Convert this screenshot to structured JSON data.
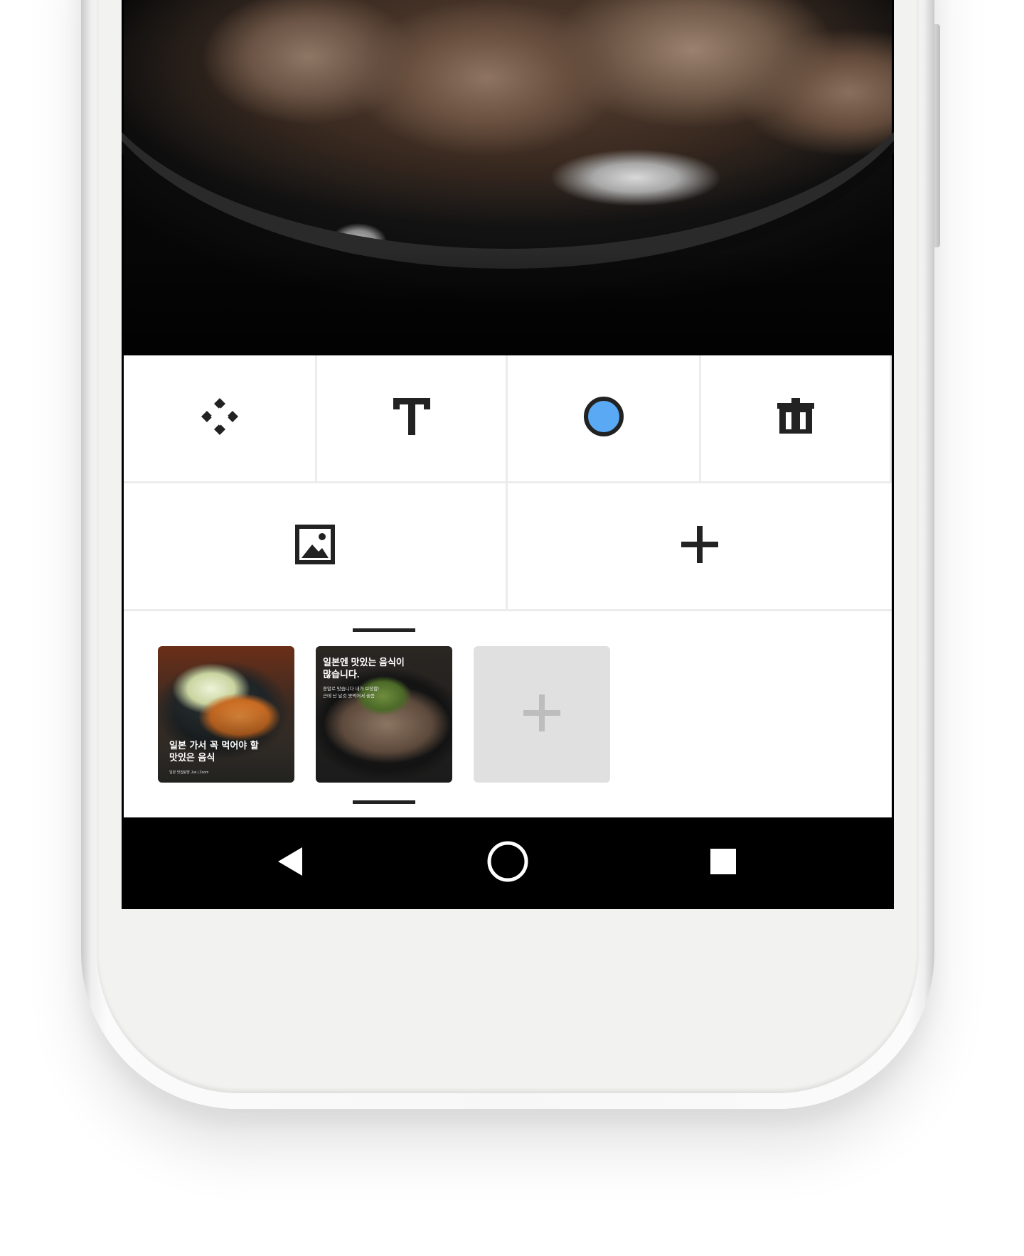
{
  "toolbar": {
    "move_icon": "move-icon",
    "text_icon": "text-icon",
    "color_icon": "color-dot-icon",
    "delete_icon": "trash-icon",
    "image_icon": "image-icon",
    "add_icon": "plus-icon"
  },
  "colors": {
    "accent_dot": "#5aa9f5",
    "icon": "#222222",
    "add_tile": "#e0e0e0"
  },
  "slides": [
    {
      "caption": "일본 가서 꼭 먹어야 할\n맛있은 음식",
      "subcaption": "일본 맛집탐방 Jun | Zoom"
    },
    {
      "title": "일본엔 맛있는 음식이\n많습니다.",
      "body": "종말로 맛습니다 내가 보장함!\n근데 난 날것 못먹어서 슬픔",
      "selected": true
    }
  ],
  "add_slide_icon": "plus-icon",
  "navbar": {
    "back_icon": "back-triangle-icon",
    "home_icon": "home-circle-icon",
    "recents_icon": "recents-square-icon"
  }
}
